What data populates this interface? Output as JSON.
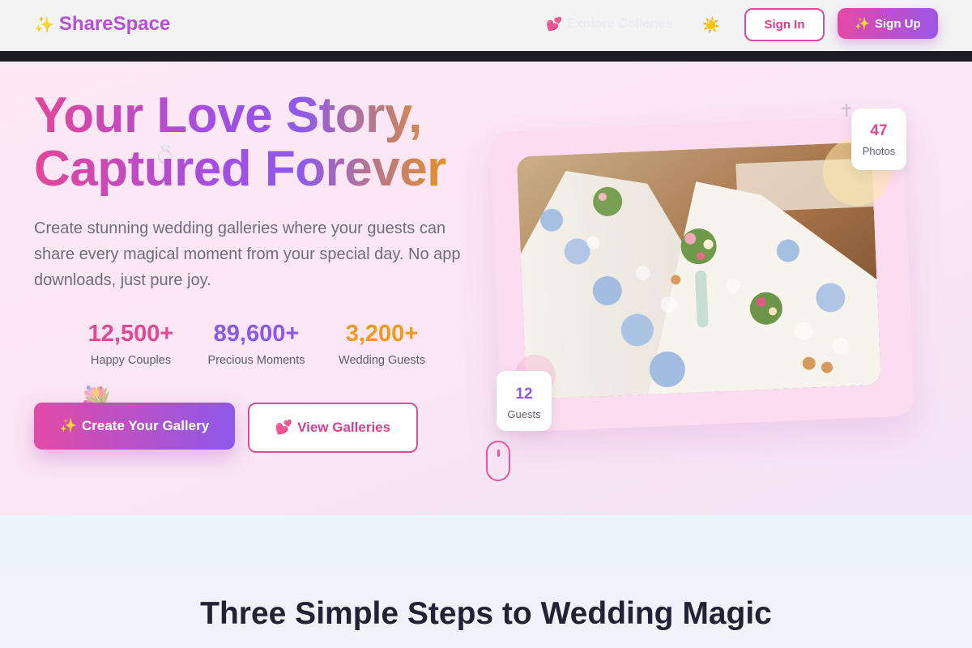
{
  "header": {
    "logo_icon": "✨",
    "logo_text": "ShareSpace",
    "explore_icon": "💕",
    "explore_label": "Explore Galleries",
    "theme_icon": "☀️",
    "signin_label": "Sign In",
    "signup_icon": "✨",
    "signup_label": "Sign Up"
  },
  "hero": {
    "title_line1": "Your Love Story,",
    "title_line2": "Captured Forever",
    "subtitle": "Create stunning wedding galleries where your guests can share every magical moment from your special day. No app downloads, just pure joy.",
    "stats": [
      {
        "value": "12,500+",
        "label": "Happy Couples",
        "color": "#e24995"
      },
      {
        "value": "89,600+",
        "label": "Precious Moments",
        "color": "#8c58e8"
      },
      {
        "value": "3,200+",
        "label": "Wedding Guests",
        "color": "#ef9a1a"
      }
    ],
    "cta_primary_icon": "✨",
    "cta_primary_label": "Create Your Gallery",
    "cta_secondary_icon": "💕",
    "cta_secondary_label": "View Galleries",
    "photo_badge": {
      "value": "47",
      "label": "Photos"
    },
    "guest_badge": {
      "value": "12",
      "label": "Guests"
    },
    "deco_bouquet": "💐",
    "deco_ring": "💍",
    "deco_cross": "✝"
  },
  "steps": {
    "title": "Three Simple Steps to Wedding Magic"
  },
  "colors": {
    "brand_pink": "#e448a6",
    "brand_purple": "#9b57e8",
    "accent_orange": "#ef9a1a"
  }
}
